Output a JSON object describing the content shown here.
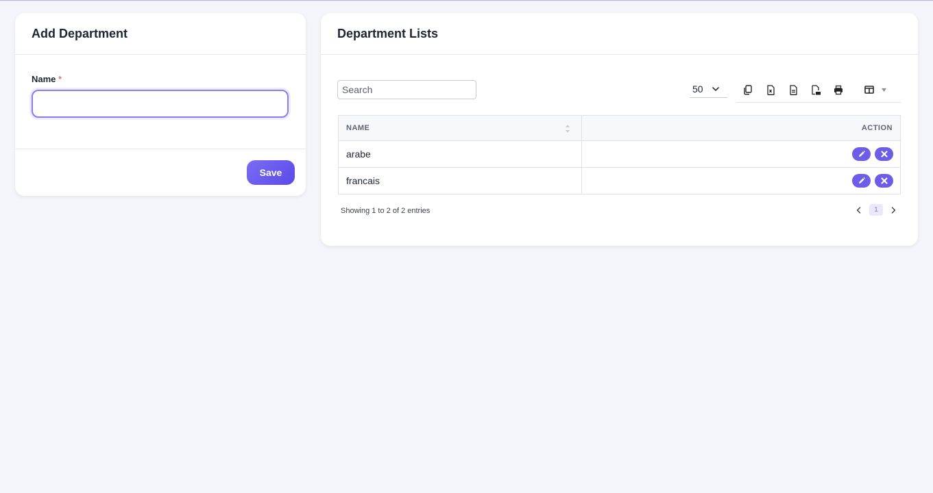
{
  "add_department": {
    "title": "Add Department",
    "name_label": "Name",
    "required_mark": "*",
    "name_value": "",
    "save_label": "Save"
  },
  "department_list": {
    "title": "Department Lists",
    "search_placeholder": "Search",
    "page_length": "50",
    "toolbar_icons": [
      "copy-icon",
      "excel-icon",
      "csv-icon",
      "pdf-icon",
      "print-icon",
      "columns-icon"
    ],
    "columns": [
      "NAME",
      "ACTION"
    ],
    "rows": [
      {
        "name": "arabe"
      },
      {
        "name": "francais"
      }
    ],
    "info": "Showing 1 to 2 of 2 entries",
    "current_page": "1"
  },
  "colors": {
    "accent": "#6c5ce7",
    "required": "#e0354a",
    "page_bg": "#f4f5fa"
  }
}
